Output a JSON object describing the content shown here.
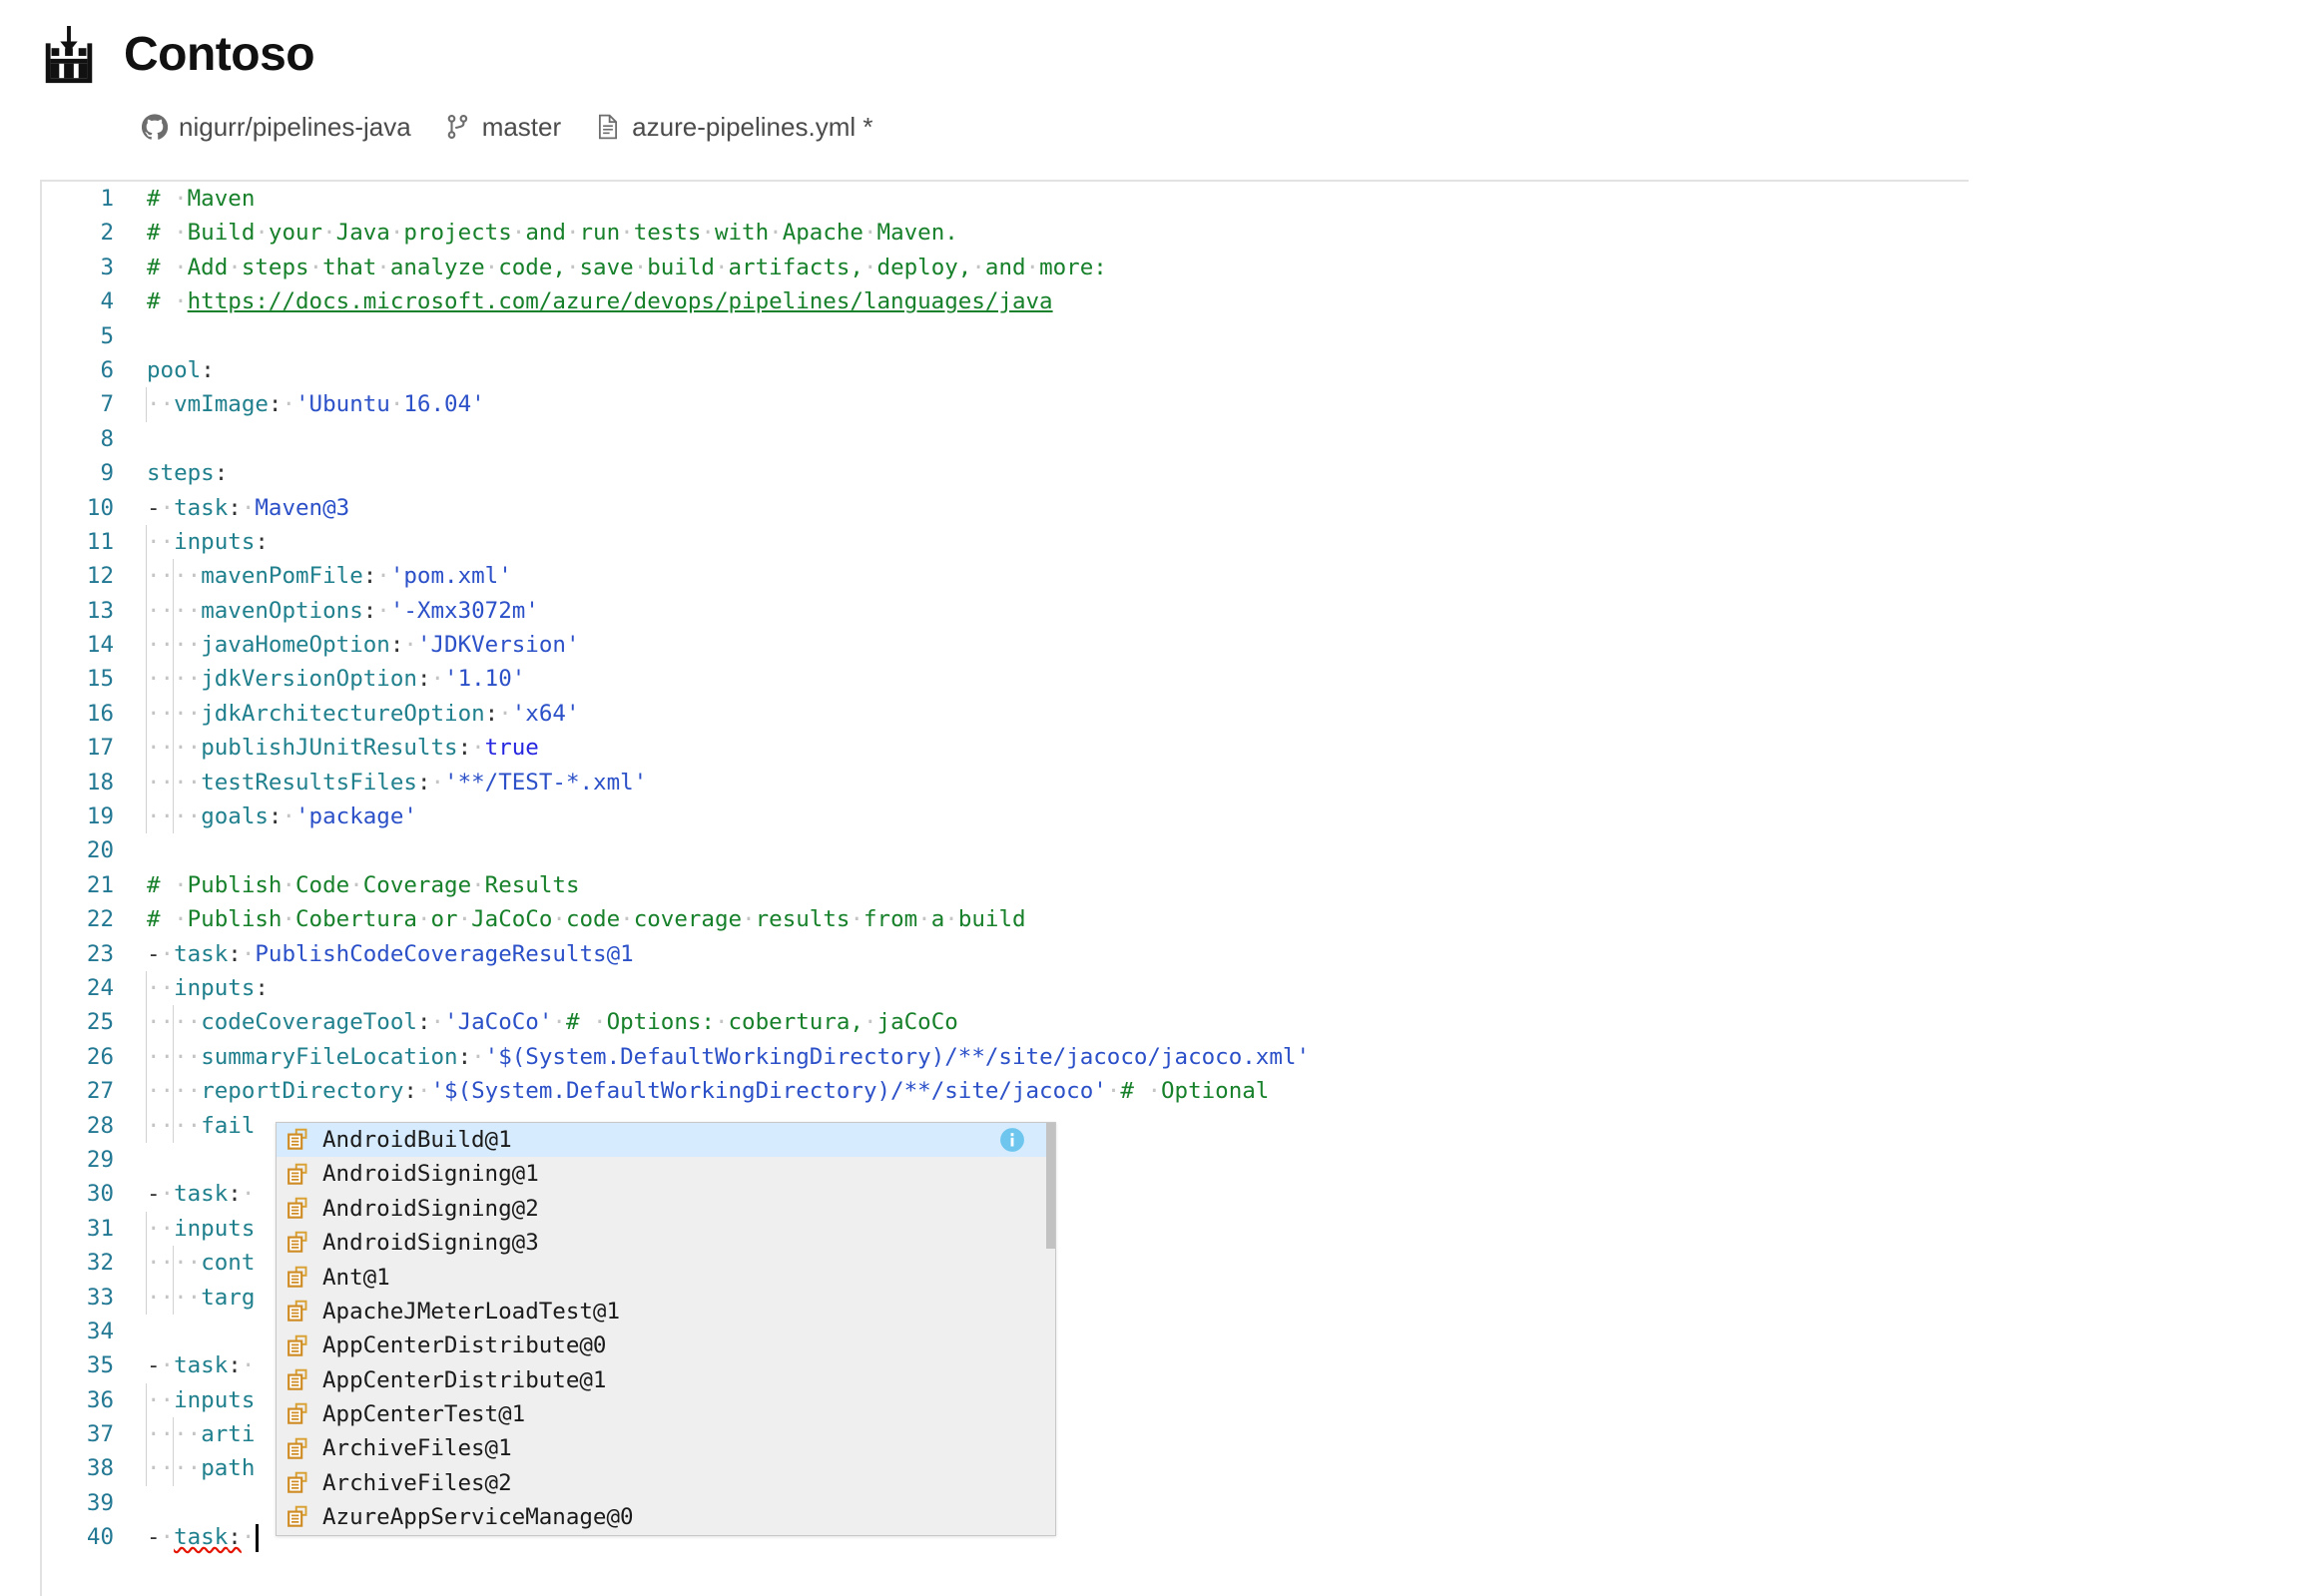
{
  "header": {
    "logo_icon": "pipeline-download-icon",
    "title": "Contoso",
    "breadcrumb": [
      {
        "icon": "github-icon",
        "label": "nigurr/pipelines-java"
      },
      {
        "icon": "branch-icon",
        "label": "master"
      },
      {
        "icon": "file-icon",
        "label": "azure-pipelines.yml *"
      }
    ]
  },
  "editor": {
    "language": "yaml",
    "first_line": 1,
    "last_line": 40,
    "cursor_line": 40,
    "colors": {
      "comment": "#17802a",
      "key": "#21808d",
      "string": "#2b50c8",
      "keyword": "#2626e0",
      "line_number": "#237893",
      "whitespace_dot": "#c4c4c4",
      "current_line_bg": "#f2f2f2",
      "error_squiggle": "#e51400"
    },
    "lines": [
      {
        "n": 1,
        "text": "# Maven"
      },
      {
        "n": 2,
        "text": "# Build your Java projects and run tests with Apache Maven."
      },
      {
        "n": 3,
        "text": "# Add steps that analyze code, save build artifacts, deploy, and more:"
      },
      {
        "n": 4,
        "text": "# https://docs.microsoft.com/azure/devops/pipelines/languages/java"
      },
      {
        "n": 5,
        "text": ""
      },
      {
        "n": 6,
        "text": "pool:"
      },
      {
        "n": 7,
        "text": "  vmImage: 'Ubuntu 16.04'"
      },
      {
        "n": 8,
        "text": ""
      },
      {
        "n": 9,
        "text": "steps:"
      },
      {
        "n": 10,
        "text": "- task: Maven@3"
      },
      {
        "n": 11,
        "text": "  inputs:"
      },
      {
        "n": 12,
        "text": "    mavenPomFile: 'pom.xml'"
      },
      {
        "n": 13,
        "text": "    mavenOptions: '-Xmx3072m'"
      },
      {
        "n": 14,
        "text": "    javaHomeOption: 'JDKVersion'"
      },
      {
        "n": 15,
        "text": "    jdkVersionOption: '1.10'"
      },
      {
        "n": 16,
        "text": "    jdkArchitectureOption: 'x64'"
      },
      {
        "n": 17,
        "text": "    publishJUnitResults: true"
      },
      {
        "n": 18,
        "text": "    testResultsFiles: '**/TEST-*.xml'"
      },
      {
        "n": 19,
        "text": "    goals: 'package'"
      },
      {
        "n": 20,
        "text": ""
      },
      {
        "n": 21,
        "text": "# Publish Code Coverage Results"
      },
      {
        "n": 22,
        "text": "# Publish Cobertura or JaCoCo code coverage results from a build"
      },
      {
        "n": 23,
        "text": "- task: PublishCodeCoverageResults@1"
      },
      {
        "n": 24,
        "text": "  inputs:"
      },
      {
        "n": 25,
        "text": "    codeCoverageTool: 'JaCoCo' # Options: cobertura, jaCoCo"
      },
      {
        "n": 26,
        "text": "    summaryFileLocation: '$(System.DefaultWorkingDirectory)/**/site/jacoco/jacoco.xml'"
      },
      {
        "n": 27,
        "text": "    reportDirectory: '$(System.DefaultWorkingDirectory)/**/site/jacoco' # Optional"
      },
      {
        "n": 28,
        "text": "    fail",
        "occluded": true
      },
      {
        "n": 29,
        "text": "",
        "occluded": true
      },
      {
        "n": 30,
        "text": "- task: ",
        "occluded": true
      },
      {
        "n": 31,
        "text": "  inputs",
        "occluded": true
      },
      {
        "n": 32,
        "text": "    cont",
        "occluded": true
      },
      {
        "n": 33,
        "text": "    targ",
        "occluded": true
      },
      {
        "n": 34,
        "text": "",
        "occluded": true
      },
      {
        "n": 35,
        "text": "- task: ",
        "occluded": true
      },
      {
        "n": 36,
        "text": "  inputs",
        "occluded": true
      },
      {
        "n": 37,
        "text": "    arti",
        "occluded": true
      },
      {
        "n": 38,
        "text": "    path",
        "occluded": true
      },
      {
        "n": 39,
        "text": "",
        "occluded": true
      },
      {
        "n": 40,
        "text": "- task: ",
        "current": true
      }
    ]
  },
  "autocomplete": {
    "visible": true,
    "selected_index": 0,
    "selected_has_info": true,
    "info_icon": "info-icon",
    "item_icon": "module-icon",
    "items": [
      {
        "label": "AndroidBuild@1"
      },
      {
        "label": "AndroidSigning@1"
      },
      {
        "label": "AndroidSigning@2"
      },
      {
        "label": "AndroidSigning@3"
      },
      {
        "label": "Ant@1"
      },
      {
        "label": "ApacheJMeterLoadTest@1"
      },
      {
        "label": "AppCenterDistribute@0"
      },
      {
        "label": "AppCenterDistribute@1"
      },
      {
        "label": "AppCenterTest@1"
      },
      {
        "label": "ArchiveFiles@1"
      },
      {
        "label": "ArchiveFiles@2"
      },
      {
        "label": "AzureAppServiceManage@0"
      }
    ]
  }
}
